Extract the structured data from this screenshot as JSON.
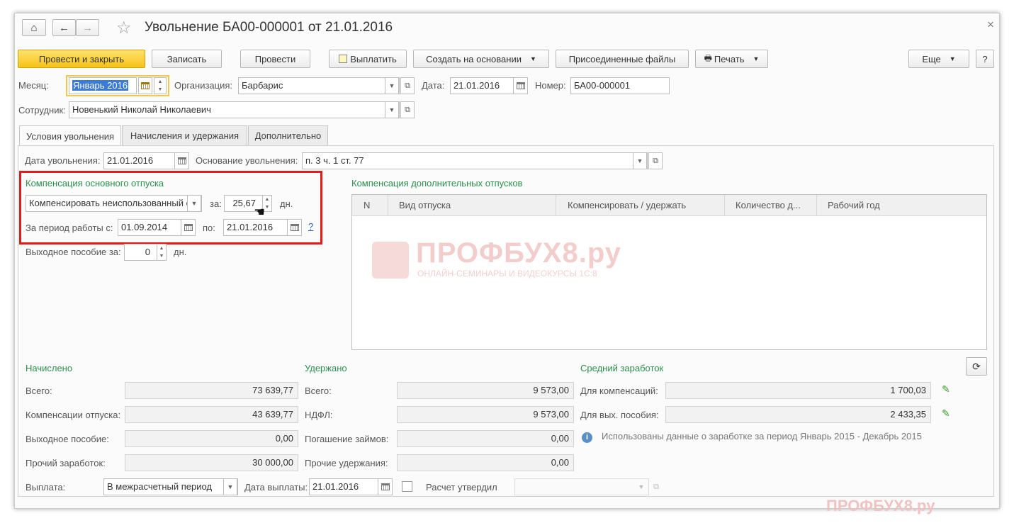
{
  "window": {
    "title": "Увольнение БА00-000001 от 21.01.2016",
    "close": "×"
  },
  "toolbar": {
    "post_close": "Провести и закрыть",
    "save": "Записать",
    "post": "Провести",
    "pay": "Выплатить",
    "create_basis": "Создать на основании",
    "attached": "Присоединенные файлы",
    "print": "Печать",
    "more": "Еще",
    "help": "?"
  },
  "header": {
    "month_label": "Месяц:",
    "month_value": "Январь 2016",
    "org_label": "Организация:",
    "org_value": "Барбарис",
    "date_label": "Дата:",
    "date_value": "21.01.2016",
    "number_label": "Номер:",
    "number_value": "БА00-000001",
    "employee_label": "Сотрудник:",
    "employee_value": "Новенький Николай Николаевич"
  },
  "tabs": [
    "Условия увольнения",
    "Начисления и удержания",
    "Дополнительно"
  ],
  "dismissal": {
    "date_label": "Дата увольнения:",
    "date_value": "21.01.2016",
    "reason_label": "Основание увольнения:",
    "reason_value": "п. 3 ч. 1 ст. 77"
  },
  "main_vacation": {
    "title": "Компенсация основного отпуска",
    "mode_value": "Компенсировать неиспользованный о",
    "for_label": "за:",
    "days_value": "25,67",
    "days_unit": "дн.",
    "period_label": "За период работы с:",
    "period_from": "01.09.2014",
    "to_label": "по:",
    "period_to": "21.01.2016",
    "help": "?"
  },
  "severance": {
    "label": "Выходное пособие за:",
    "value": "0",
    "unit": "дн."
  },
  "extra_vacations": {
    "title": "Компенсация дополнительных отпусков",
    "columns": [
      "N",
      "Вид отпуска",
      "Компенсировать / удержать",
      "Количество д...",
      "Рабочий год"
    ]
  },
  "watermark": {
    "brand": "ПРОФБУХ8.ру",
    "tagline": "ОНЛАЙН-СЕМИНАРЫ И ВИДЕОКУРСЫ 1С:8",
    "footer_brand": "ПРОФБУХ8.ру"
  },
  "accrued": {
    "title": "Начислено",
    "rows": [
      {
        "label": "Всего:",
        "value": "73 639,77"
      },
      {
        "label": "Компенсации отпуска:",
        "value": "43 639,77"
      },
      {
        "label": "Выходное пособие:",
        "value": "0,00"
      },
      {
        "label": "Прочий заработок:",
        "value": "30 000,00"
      }
    ]
  },
  "withheld": {
    "title": "Удержано",
    "rows": [
      {
        "label": "Всего:",
        "value": "9 573,00"
      },
      {
        "label": "НДФЛ:",
        "value": "9 573,00"
      },
      {
        "label": "Погашение займов:",
        "value": "0,00"
      },
      {
        "label": "Прочие удержания:",
        "value": "0,00"
      }
    ]
  },
  "avg_earnings": {
    "title": "Средний заработок",
    "rows": [
      {
        "label": "Для компенсаций:",
        "value": "1 700,03"
      },
      {
        "label": "Для вых. пособия:",
        "value": "2 433,35"
      }
    ],
    "info": "Использованы данные о заработке за период Январь 2015 - Декабрь 2015"
  },
  "footer": {
    "payment_label": "Выплата:",
    "payment_value": "В межрасчетный период",
    "pay_date_label": "Дата выплаты:",
    "pay_date_value": "21.01.2016",
    "approved_label": "Расчет утвердил",
    "approved_value": ""
  },
  "colors": {
    "accent_green": "#2c8f4c",
    "highlight_red": "#e21b1b",
    "primary_yellow": "#f6c21a",
    "watermark": "#f3c9c9"
  }
}
